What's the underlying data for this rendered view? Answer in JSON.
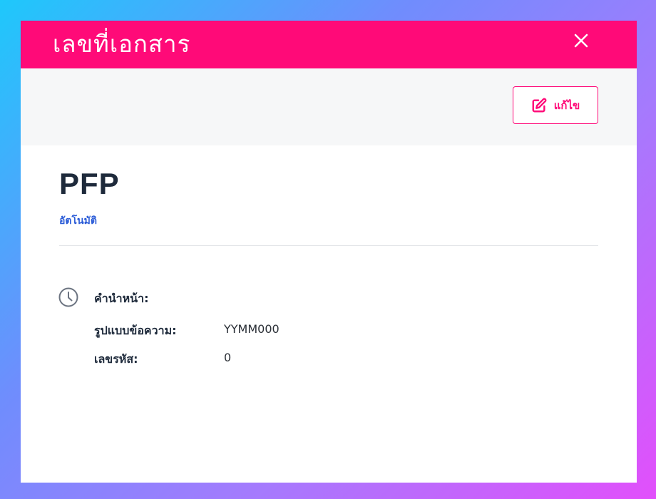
{
  "modal": {
    "title": "เลขที่เอกสาร",
    "close_icon": "close-icon"
  },
  "toolbar": {
    "edit_label": "แก้ไข",
    "edit_icon": "edit-icon"
  },
  "document": {
    "code": "PFP",
    "mode": "อัตโนมัติ"
  },
  "details": {
    "icon": "clock-icon",
    "prefix_label": "คำนำหน้า:",
    "prefix_value": "",
    "format_label": "รูปแบบข้อความ:",
    "format_value": "YYMM000",
    "number_label": "เลขรหัส:",
    "number_value": "0"
  },
  "colors": {
    "accent": "#ff0a78",
    "link": "#2a5bd7",
    "heading": "#1e2a3b"
  }
}
